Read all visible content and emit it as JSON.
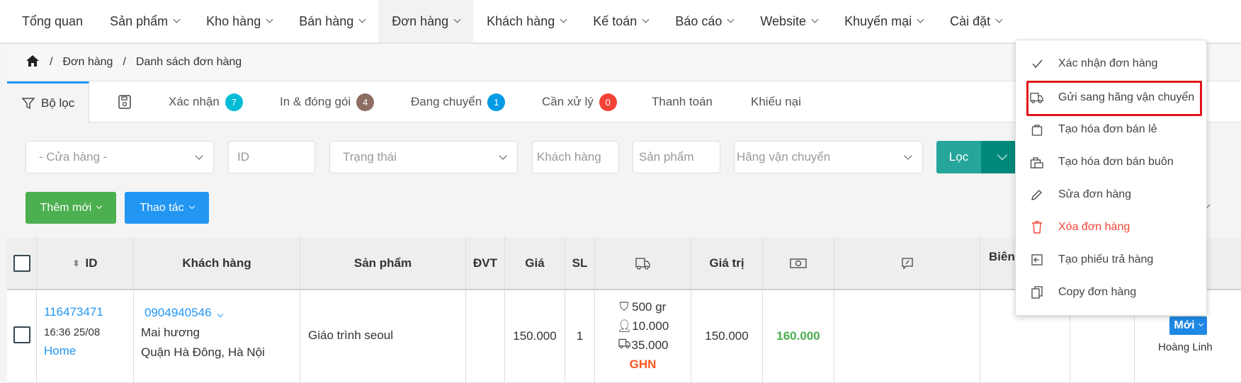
{
  "nav": {
    "items": [
      "Tổng quan",
      "Sản phẩm",
      "Kho hàng",
      "Bán hàng",
      "Đơn hàng",
      "Khách hàng",
      "Kế toán",
      "Báo cáo",
      "Website",
      "Khuyến mại",
      "Cài đặt"
    ],
    "active": "Đơn hàng"
  },
  "breadcrumb": {
    "items": [
      "Đơn hàng",
      "Danh sách đơn hàng"
    ],
    "sep": "/"
  },
  "tabs": {
    "filter": "Bộ lọc",
    "items": [
      {
        "label": "Xác nhận",
        "count": "7",
        "color": "#00bcd4"
      },
      {
        "label": "In & đóng gói",
        "count": "4",
        "color": "#8d6e63"
      },
      {
        "label": "Đang chuyển",
        "count": "1",
        "color": "#039be5"
      },
      {
        "label": "Cần xử lý",
        "count": "0",
        "color": "#f44336"
      },
      {
        "label": "Thanh toán"
      },
      {
        "label": "Khiếu nại"
      }
    ]
  },
  "filters": {
    "store": "- Cửa hàng -",
    "id": "ID",
    "status": "Trạng thái",
    "customer": "Khách hàng",
    "product": "Sản phẩm",
    "carrier": "Hãng vận chuyển",
    "filter_btn": "Lọc"
  },
  "actions": {
    "add": "Thêm mới",
    "ops": "Thao tác"
  },
  "table": {
    "headers": {
      "id": "ID",
      "customer": "Khách hàng",
      "product": "Sản phẩm",
      "unit": "ĐVT",
      "price": "Giá",
      "qty": "SL",
      "value": "Giá trị",
      "bien": "Biên"
    },
    "rows": [
      {
        "id": "116473471",
        "time": "16:36 25/08",
        "source": "Home",
        "phone": "0904940546",
        "name": "Mai hương",
        "address": "Quận Hà Đông, Hà Nội",
        "product": "Giáo trình seoul",
        "unit": "",
        "price": "150.000",
        "qty": "1",
        "weight": "500 gr",
        "fee_customer": "10.000",
        "ship": "35.000",
        "carrier": "GHN",
        "value": "150.000",
        "total": "160.000",
        "status": "Mới",
        "staff": "Hoàng Linh"
      }
    ]
  },
  "menu": {
    "items": [
      {
        "label": "Xác nhận đơn hàng",
        "icon": "check-icon"
      },
      {
        "label": "Gửi sang hãng vận chuyển",
        "icon": "truck-icon",
        "highlighted": true
      },
      {
        "label": "Tạo hóa đơn bán lẻ",
        "icon": "bag-icon"
      },
      {
        "label": "Tạo hóa đơn bán buôn",
        "icon": "shop-bag-icon"
      },
      {
        "label": "Sửa đơn hàng",
        "icon": "pencil-icon"
      },
      {
        "label": "Xóa đơn hàng",
        "icon": "trash-icon",
        "danger": true
      },
      {
        "label": "Tạo phiếu trả hàng",
        "icon": "return-icon"
      },
      {
        "label": "Copy đơn hàng",
        "icon": "copy-icon"
      }
    ]
  },
  "colors": {
    "link": "#2196f3",
    "green": "#4caf50",
    "teal": "#26a69a",
    "teal_dark": "#00897b",
    "danger": "#f44336",
    "carrier": "#ff5722",
    "highlight": "#e0161c"
  }
}
